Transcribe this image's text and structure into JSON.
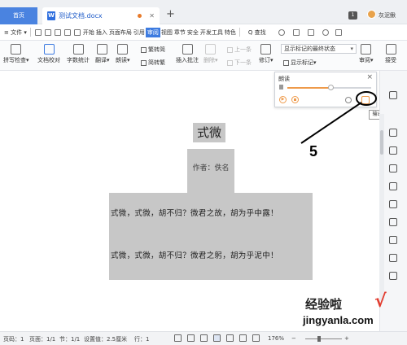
{
  "titlebar": {
    "home_tab": "首页",
    "doc_tab": "测试文档.docx",
    "plus": "+",
    "badge": "1",
    "username": "灰泥鳅"
  },
  "menubar": {
    "file_menu": "≡ 文件 ▾",
    "items": [
      "开始",
      "插入",
      "页面布局",
      "引用",
      "审阅",
      "视图",
      "章节",
      "安全",
      "开发工具",
      "特色"
    ],
    "active": "审阅",
    "search": "Q 查找"
  },
  "toolbar": {
    "spellcheck": "拼写检查▾",
    "doc_proof": "文档校对",
    "word_count": "字数统计",
    "translate": "翻译▾",
    "read_aloud": "朗读▾",
    "simp_to_trad": "繁转简",
    "trad_to_simp": "简转繁",
    "insert_comment": "插入批注",
    "delete": "删除▾",
    "prev": "上一条",
    "next": "下一条",
    "revise": "修订▾",
    "markup_dropdown": "显示标记的最终状态",
    "show_markup": "显示标记▾",
    "review": "审阅▾",
    "accept": "接受"
  },
  "document": {
    "title": "式微",
    "author": "作者：佚名",
    "line1": "式微，式微，胡不归？微君之故，胡为乎中露！",
    "line2": "式微，式微，胡不归？微君之躬，胡为乎泥中！"
  },
  "read_panel": {
    "title": "朗读",
    "close": "×",
    "play": "▶",
    "tooltip": "输出语音"
  },
  "annotation": {
    "number": "5"
  },
  "statusbar": {
    "page_num": "页码：1",
    "page": "页面：1/1",
    "section": "节：1/1",
    "setting": "设置值：2.5厘米",
    "row": "行：1",
    "zoom": "176%"
  },
  "watermark": {
    "text": "经验啦",
    "check": "√",
    "url": "jingyanla.com"
  }
}
